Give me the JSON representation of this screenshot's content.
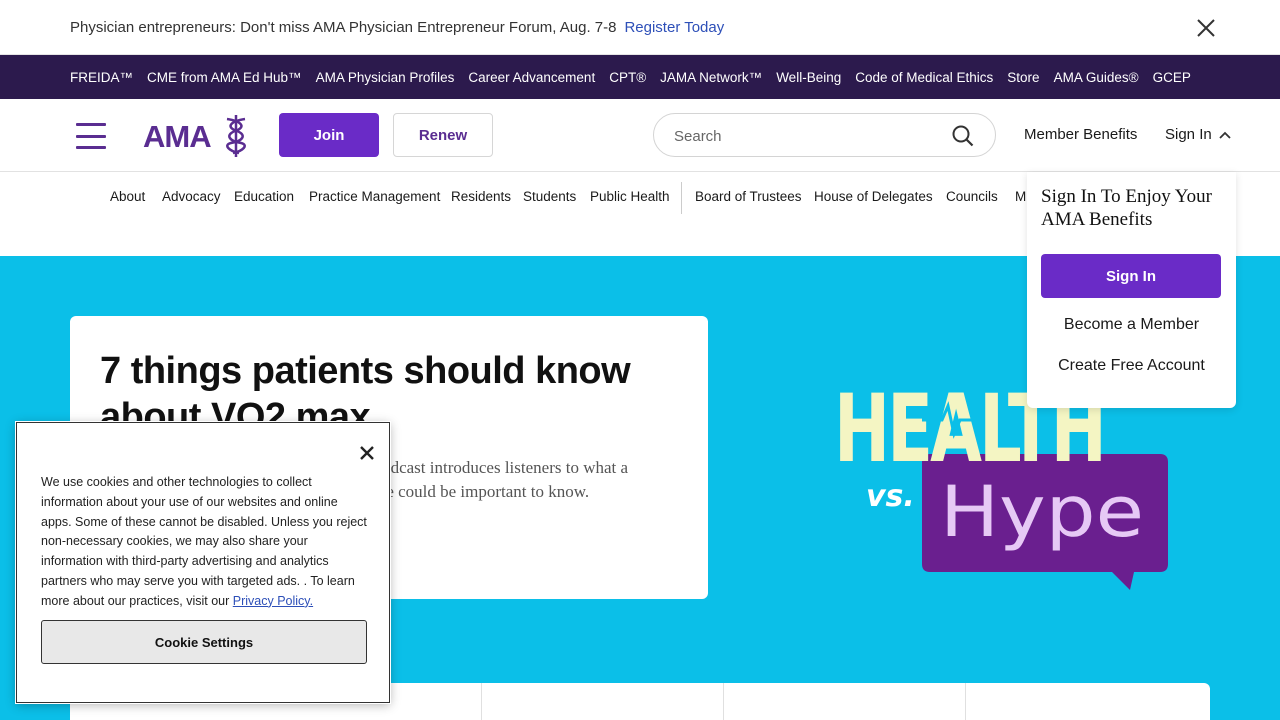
{
  "promo": {
    "text": "Physician entrepreneurs: Don't miss AMA Physician Entrepreneur Forum, Aug. 7-8",
    "link": "Register Today"
  },
  "topnav": [
    "FREIDA™",
    "CME from AMA Ed Hub™",
    "AMA Physician Profiles",
    "Career Advancement",
    "CPT®",
    "JAMA Network™",
    "Well-Being",
    "Code of Medical Ethics",
    "Store",
    "AMA Guides®",
    "GCEP"
  ],
  "header": {
    "logo": "AMA",
    "join": "Join",
    "renew": "Renew",
    "search_placeholder": "Search",
    "member_benefits": "Member Benefits",
    "sign_in": "Sign In"
  },
  "subnav": [
    "About",
    "Advocacy",
    "Education",
    "Practice Management",
    "Residents",
    "Students",
    "Public Health",
    "Board of Trustees",
    "House of Delegates",
    "Councils",
    "M"
  ],
  "hero": {
    "title": "7 things patients should know about VO2 max",
    "desc_line1": "A podcast introduces listeners to what a",
    "desc_line2": "score could be important to know.",
    "art_word1": "HEALTH",
    "art_word2": "vs.",
    "art_word3": "Hype"
  },
  "dropdown": {
    "heading": "Sign In To Enjoy Your AMA Benefits",
    "sign_in_button": "Sign In",
    "become_member": "Become a Member",
    "create_account": "Create Free Account"
  },
  "cookie": {
    "text": "We use cookies and other technologies to collect information about your use of our websites and online apps. Some of these cannot be disabled. Unless you reject non-necessary cookies, we may also share your information with third-party advertising and analytics partners who may serve you with targeted ads. . To learn more about our practices, visit our",
    "link": "Privacy Policy.",
    "settings_button": "Cookie Settings"
  },
  "colors": {
    "brand_purple": "#5a2d91",
    "button_purple": "#6a2bc7",
    "topbar": "#2c1a4d",
    "hero_bg": "#0bbfe8"
  }
}
